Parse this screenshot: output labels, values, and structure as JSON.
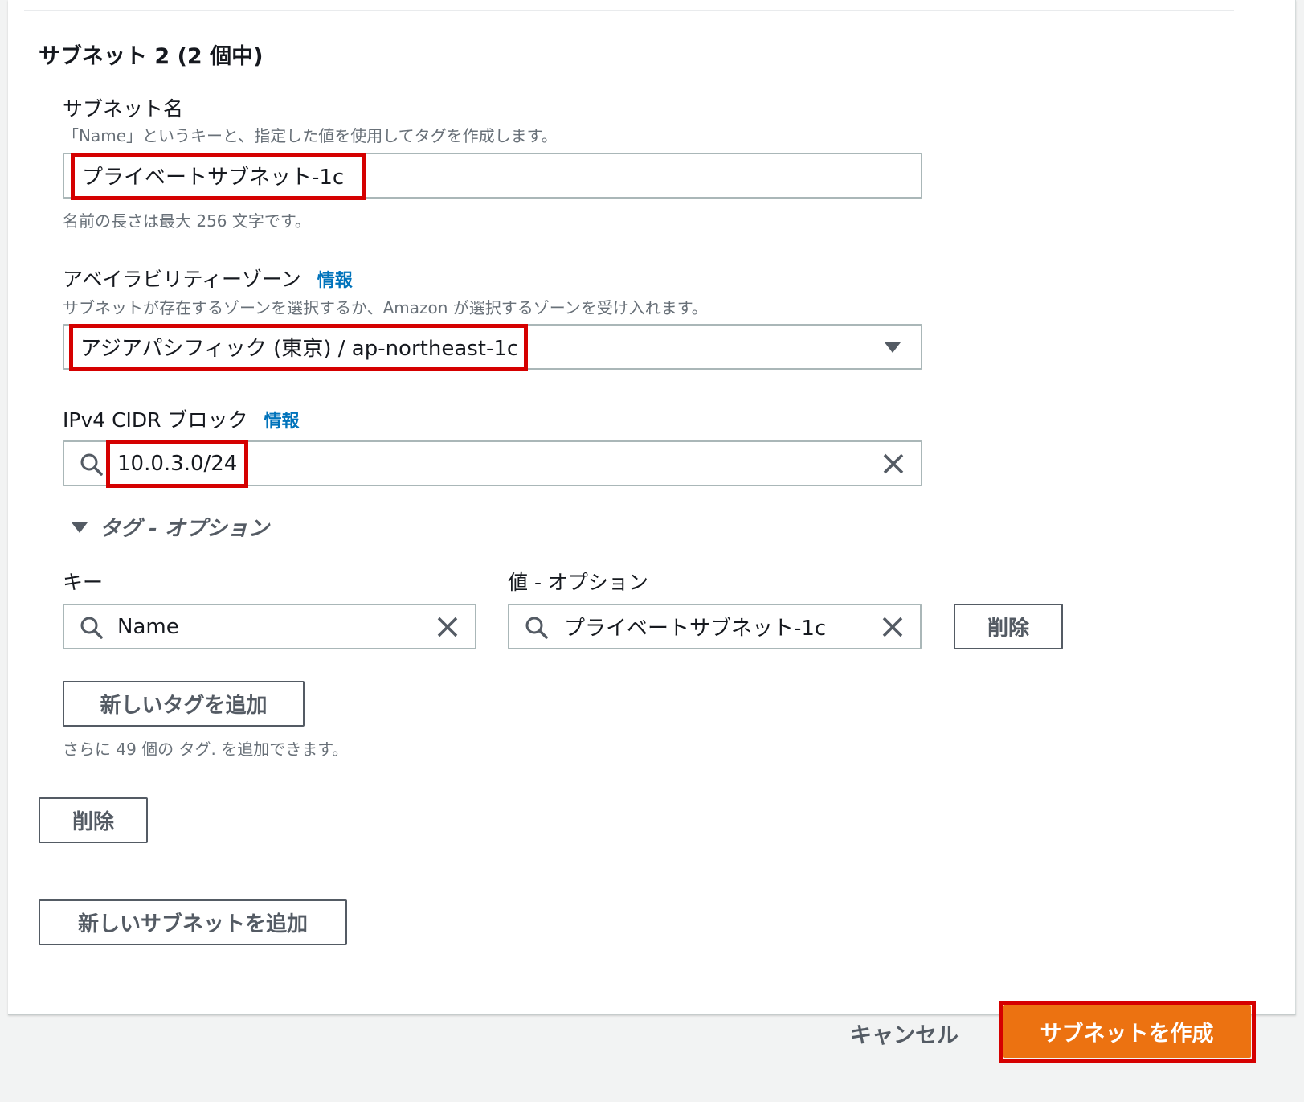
{
  "section": {
    "title": "サブネット 2 (2 個中)"
  },
  "subnet_name": {
    "label": "サブネット名",
    "description": "「Name」というキーと、指定した値を使用してタグを作成します。",
    "value": "プライベートサブネット-1c",
    "constraint": "名前の長さは最大 256 文字です。"
  },
  "availability_zone": {
    "label": "アベイラビリティーゾーン",
    "info": "情報",
    "description": "サブネットが存在するゾーンを選択するか、Amazon が選択するゾーンを受け入れます。",
    "value": "アジアパシフィック (東京) / ap-northeast-1c"
  },
  "cidr": {
    "label": "IPv4 CIDR ブロック",
    "info": "情報",
    "value": "10.0.3.0/24"
  },
  "tags": {
    "toggle_label": "タグ - オプション",
    "key_label": "キー",
    "value_label": "値 - オプション",
    "key_value": "Name",
    "value_value": "プライベートサブネット-1c",
    "remove_button": "削除",
    "add_button": "新しいタグを追加",
    "remaining_text": "さらに 49 個の タグ. を追加できます。"
  },
  "remove_subnet_button": "削除",
  "add_subnet_button": "新しいサブネットを追加",
  "footer": {
    "cancel": "キャンセル",
    "create": "サブネットを作成"
  },
  "colors": {
    "highlight": "#d50000",
    "primary": "#ec7211",
    "link": "#0073bb"
  }
}
